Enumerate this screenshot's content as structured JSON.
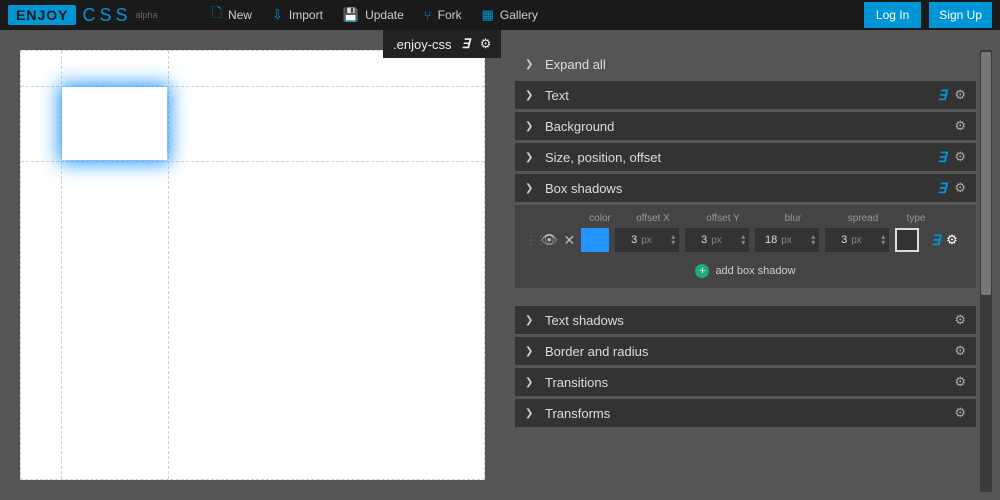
{
  "logo": {
    "brand": "ENJOY",
    "product": "CSS",
    "tag": "alpha"
  },
  "top_actions": {
    "new": "New",
    "import": "Import",
    "update": "Update",
    "fork": "Fork",
    "gallery": "Gallery"
  },
  "auth": {
    "login": "Log In",
    "signup": "Sign Up"
  },
  "selector": ".enjoy-css",
  "panels": {
    "expand_all": "Expand all",
    "text": "Text",
    "background": "Background",
    "size": "Size, position, offset",
    "box_shadows": "Box shadows",
    "text_shadows": "Text shadows",
    "border": "Border and radius",
    "transitions": "Transitions",
    "transforms": "Transforms"
  },
  "shadow_cols": {
    "color": "color",
    "offsetX": "offset X",
    "offsetY": "offset Y",
    "blur": "blur",
    "spread": "spread",
    "type": "type"
  },
  "shadow_row": {
    "color": "#2196ff",
    "offsetX": "3",
    "offsetY": "3",
    "blur": "18",
    "spread": "3",
    "unit": "px"
  },
  "add_shadow": "add box shadow"
}
